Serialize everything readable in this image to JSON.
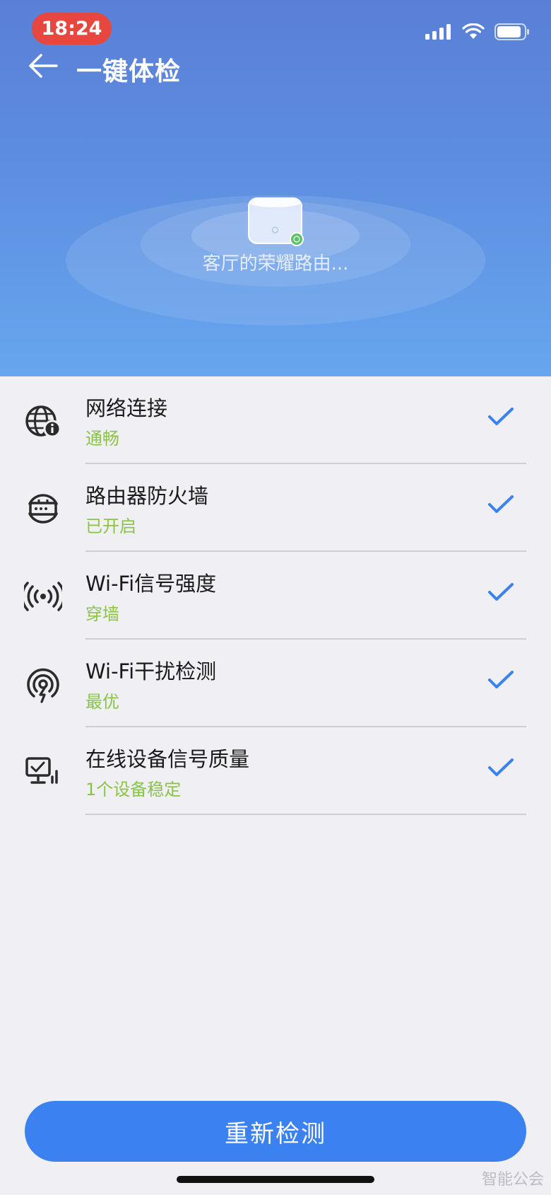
{
  "status_bar": {
    "time": "18:24"
  },
  "nav": {
    "title": "一键体检"
  },
  "hero": {
    "router_name": "客厅的荣耀路由..."
  },
  "checks": [
    {
      "title": "网络连接",
      "status": "通畅",
      "icon": "globe-info-icon"
    },
    {
      "title": "路由器防火墙",
      "status": "已开启",
      "icon": "router-firewall-icon"
    },
    {
      "title": "Wi-Fi信号强度",
      "status": "穿墙",
      "icon": "signal-waves-icon"
    },
    {
      "title": "Wi-Fi干扰检测",
      "status": "最优",
      "icon": "wifi-interference-icon"
    },
    {
      "title": "在线设备信号质量",
      "status": "1个设备稳定",
      "icon": "monitor-device-icon"
    }
  ],
  "actions": {
    "recheck_label": "重新检测"
  },
  "watermark": "智能公会",
  "colors": {
    "accent": "#3b82f0",
    "ok": "#8bc34a",
    "time_pill": "#e8473f"
  }
}
